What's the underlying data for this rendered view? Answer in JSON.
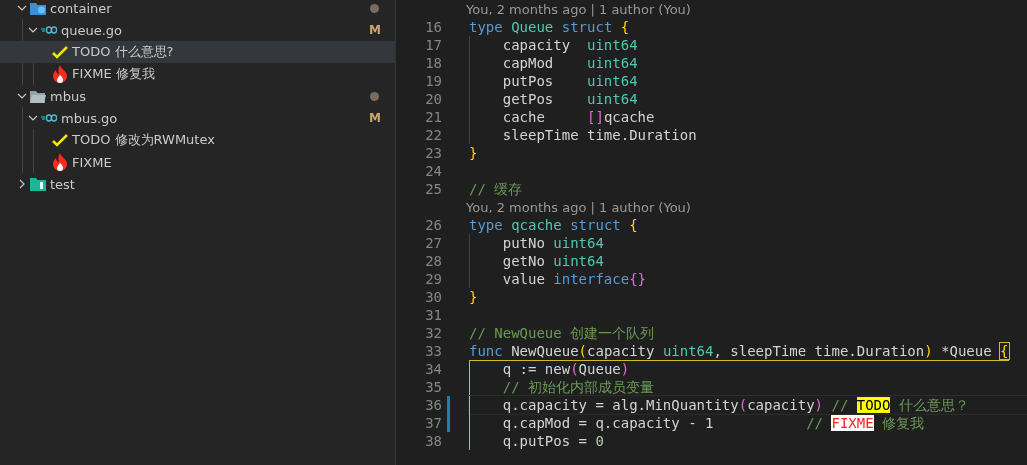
{
  "explorer": {
    "tree": [
      {
        "kind": "folder",
        "label": "container",
        "expanded": true,
        "dot": true,
        "selected": false,
        "children": [
          {
            "kind": "file",
            "label": "queue.go",
            "expanded": true,
            "badge": "M",
            "selected": false,
            "children": [
              {
                "kind": "todo",
                "label": "TODO 什么意思?",
                "selected": true
              },
              {
                "kind": "fixme",
                "label": "FIXME 修复我",
                "selected": false
              }
            ]
          }
        ]
      },
      {
        "kind": "folder",
        "label": "mbus",
        "expanded": true,
        "dot": true,
        "selected": false,
        "children": [
          {
            "kind": "file",
            "label": "mbus.go",
            "expanded": true,
            "badge": "M",
            "selected": false,
            "children": [
              {
                "kind": "todo",
                "label": "TODO 修改为RWMutex",
                "selected": false
              },
              {
                "kind": "fixme",
                "label": "FIXME",
                "selected": false
              }
            ]
          }
        ]
      },
      {
        "kind": "folder",
        "label": "test",
        "expanded": false,
        "dot": false,
        "selected": false
      }
    ]
  },
  "editor": {
    "rows": [
      {
        "kind": "codelens",
        "text": "You, 2 months ago | 1 author (You)"
      },
      {
        "kind": "line",
        "number": "16",
        "tokens": [
          {
            "kind": "kw",
            "text": "type "
          },
          {
            "kind": "type",
            "text": "Queue"
          },
          {
            "kind": "kw",
            "text": " struct "
          },
          {
            "kind": "b1",
            "text": "{"
          }
        ]
      },
      {
        "kind": "line",
        "number": "17",
        "guide": true,
        "tokens": [
          {
            "kind": "plain",
            "text": "    capacity  "
          },
          {
            "kind": "type",
            "text": "uint64"
          }
        ]
      },
      {
        "kind": "line",
        "number": "18",
        "guide": true,
        "tokens": [
          {
            "kind": "plain",
            "text": "    capMod    "
          },
          {
            "kind": "type",
            "text": "uint64"
          }
        ]
      },
      {
        "kind": "line",
        "number": "19",
        "guide": true,
        "tokens": [
          {
            "kind": "plain",
            "text": "    putPos    "
          },
          {
            "kind": "type",
            "text": "uint64"
          }
        ]
      },
      {
        "kind": "line",
        "number": "20",
        "guide": true,
        "tokens": [
          {
            "kind": "plain",
            "text": "    getPos    "
          },
          {
            "kind": "type",
            "text": "uint64"
          }
        ]
      },
      {
        "kind": "line",
        "number": "21",
        "guide": true,
        "tokens": [
          {
            "kind": "plain",
            "text": "    cache     "
          },
          {
            "kind": "b2",
            "text": "[]"
          },
          {
            "kind": "plain",
            "text": "qcache"
          }
        ]
      },
      {
        "kind": "line",
        "number": "22",
        "guide": true,
        "tokens": [
          {
            "kind": "plain",
            "text": "    sleepTime time.Duration"
          }
        ]
      },
      {
        "kind": "line",
        "number": "23",
        "tokens": [
          {
            "kind": "b1",
            "text": "}"
          }
        ]
      },
      {
        "kind": "line",
        "number": "24"
      },
      {
        "kind": "line",
        "number": "25",
        "tokens": [
          {
            "kind": "comment",
            "text": "// 缓存"
          }
        ]
      },
      {
        "kind": "codelens",
        "text": "You, 2 months ago | 1 author (You)"
      },
      {
        "kind": "line",
        "number": "26",
        "tokens": [
          {
            "kind": "kw",
            "text": "type "
          },
          {
            "kind": "type",
            "text": "qcache"
          },
          {
            "kind": "kw",
            "text": " struct "
          },
          {
            "kind": "b1",
            "text": "{"
          }
        ]
      },
      {
        "kind": "line",
        "number": "27",
        "guide": true,
        "tokens": [
          {
            "kind": "plain",
            "text": "    putNo "
          },
          {
            "kind": "type",
            "text": "uint64"
          }
        ]
      },
      {
        "kind": "line",
        "number": "28",
        "guide": true,
        "tokens": [
          {
            "kind": "plain",
            "text": "    getNo "
          },
          {
            "kind": "type",
            "text": "uint64"
          }
        ]
      },
      {
        "kind": "line",
        "number": "29",
        "guide": true,
        "tokens": [
          {
            "kind": "plain",
            "text": "    value "
          },
          {
            "kind": "kw",
            "text": "interface"
          },
          {
            "kind": "b2",
            "text": "{}"
          }
        ]
      },
      {
        "kind": "line",
        "number": "30",
        "tokens": [
          {
            "kind": "b1",
            "text": "}"
          }
        ]
      },
      {
        "kind": "line",
        "number": "31"
      },
      {
        "kind": "line",
        "number": "32",
        "tokens": [
          {
            "kind": "comment",
            "text": "// NewQueue 创建一个队列"
          }
        ]
      },
      {
        "kind": "line",
        "number": "33",
        "scope_top": true,
        "tokens": [
          {
            "kind": "kw",
            "text": "func "
          },
          {
            "kind": "plain",
            "text": "NewQueue"
          },
          {
            "kind": "b1",
            "text": "("
          },
          {
            "kind": "plain",
            "text": "capacity "
          },
          {
            "kind": "type",
            "text": "uint64"
          },
          {
            "kind": "plain",
            "text": ", sleepTime time.Duration"
          },
          {
            "kind": "b1",
            "text": ")"
          },
          {
            "kind": "plain",
            "text": " *Queue "
          },
          {
            "kind": "bracket-match",
            "text": "{"
          }
        ]
      },
      {
        "kind": "line",
        "number": "34",
        "scope": true,
        "tokens": [
          {
            "kind": "plain",
            "text": "    q := new"
          },
          {
            "kind": "b2",
            "text": "("
          },
          {
            "kind": "plain",
            "text": "Queue"
          },
          {
            "kind": "b2",
            "text": ")"
          }
        ]
      },
      {
        "kind": "line",
        "number": "35",
        "scope": true,
        "tokens": [
          {
            "kind": "comment",
            "text": "    // 初始化内部成员变量"
          }
        ]
      },
      {
        "kind": "line",
        "number": "36",
        "scope": true,
        "current": true,
        "modified": true,
        "tokens": [
          {
            "kind": "plain",
            "text": "    q.capacity = alg.MinQuantity"
          },
          {
            "kind": "b2",
            "text": "("
          },
          {
            "kind": "plain",
            "text": "capacity"
          },
          {
            "kind": "b2",
            "text": ")"
          },
          {
            "kind": "comment",
            "text": " // "
          },
          {
            "kind": "todo-tag",
            "text": "TODO"
          },
          {
            "kind": "comment",
            "text": " 什么意思？"
          }
        ]
      },
      {
        "kind": "line",
        "number": "37",
        "scope": true,
        "modified": true,
        "tokens": [
          {
            "kind": "plain",
            "text": "    q.capMod = q.capacity - 1"
          },
          {
            "kind": "comment",
            "text": "           // "
          },
          {
            "kind": "fixme-tag",
            "text": "FIXME"
          },
          {
            "kind": "comment",
            "text": " 修复我"
          }
        ]
      },
      {
        "kind": "line",
        "number": "38",
        "scope": true,
        "tokens": [
          {
            "kind": "plain",
            "text": "    q.putPos = "
          },
          {
            "kind": "num",
            "text": "0"
          }
        ]
      }
    ]
  }
}
